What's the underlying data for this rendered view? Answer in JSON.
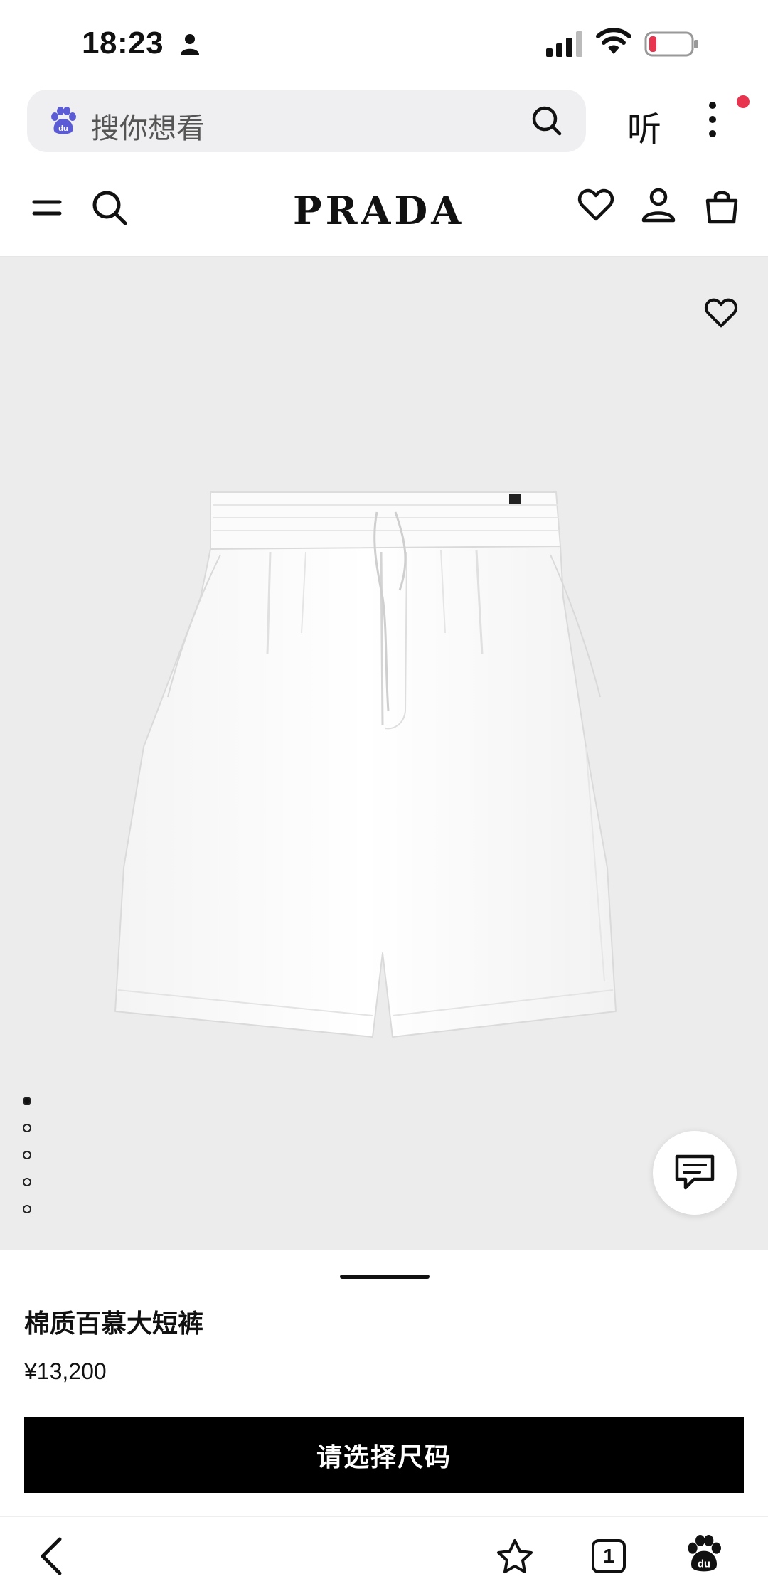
{
  "status_bar": {
    "time": "18:23",
    "battery_color": "#e8344e"
  },
  "browser": {
    "search_placeholder": "搜你想看",
    "listen_label": "听",
    "accent_color": "#5b5bd6",
    "notification_color": "#e8344e"
  },
  "site": {
    "logo": "PRADA",
    "icons": [
      "menu-icon",
      "search-icon",
      "heart-icon",
      "account-icon",
      "bag-icon"
    ]
  },
  "product": {
    "name": "棉质百慕大短裤",
    "price": "¥13,200",
    "cta_label": "请选择尺码",
    "image_count": 5,
    "active_image_index": 0
  },
  "toolbar": {
    "tab_count": "1",
    "icons": [
      "back-icon",
      "star-icon",
      "tabs-icon",
      "baidu-icon"
    ]
  }
}
